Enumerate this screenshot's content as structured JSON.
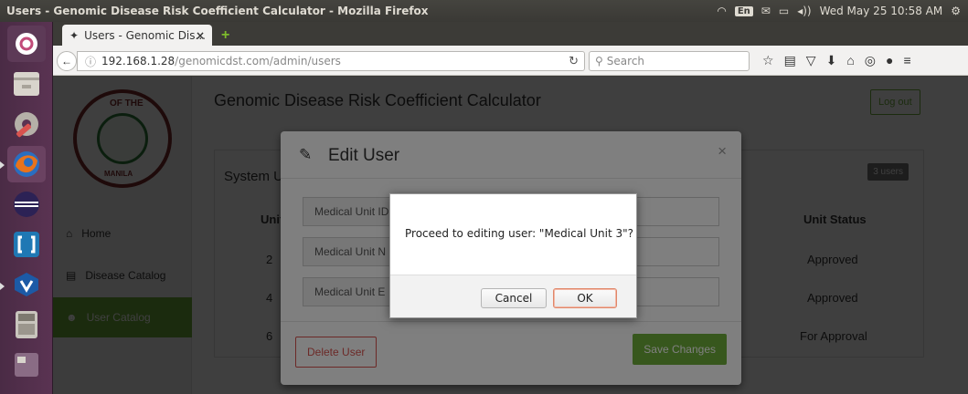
{
  "os_panel": {
    "window_title": "Users - Genomic Disease Risk Coefficient Calculator - Mozilla Firefox",
    "keyboard_indicator": "En",
    "clock": "Wed May 25 10:58 AM"
  },
  "browser": {
    "tab_title": "Users - Genomic Dis...",
    "tab_close": "×",
    "new_tab": "+",
    "url_host": "192.168.1.28",
    "url_path": "/genomicdst.com/admin/users",
    "search_placeholder": "Search"
  },
  "app": {
    "title": "Genomic Disease Risk Coefficient Calculator",
    "logout_label": "Log out",
    "seal_text_top": "OF THE",
    "seal_text_bottom": "MANILA",
    "nav": [
      {
        "label": "Home",
        "icon": "home-icon"
      },
      {
        "label": "Disease Catalog",
        "icon": "document-icon"
      },
      {
        "label": "User Catalog",
        "icon": "users-icon"
      }
    ],
    "panel_title": "System U",
    "users_count_badge": "3 users",
    "columns": {
      "unit_id": "Unit ID",
      "unit_status": "Unit Status"
    },
    "rows": [
      {
        "unit_id": "2",
        "status": "Approved"
      },
      {
        "unit_id": "4",
        "status": "Approved"
      },
      {
        "unit_id": "6",
        "status": "For Approval"
      }
    ]
  },
  "edit_modal": {
    "title": "Edit User",
    "close": "×",
    "fields": [
      {
        "label": "Medical Unit ID",
        "value": ""
      },
      {
        "label": "Medical Unit N",
        "value": ""
      },
      {
        "label": "Medical Unit E",
        "value": ""
      }
    ],
    "delete_label": "Delete User",
    "save_label": "Save Changes"
  },
  "confirm_dialog": {
    "message": "Proceed to editing user: \"Medical Unit 3\"?",
    "cancel_label": "Cancel",
    "ok_label": "OK"
  },
  "colors": {
    "accent_green": "#6fae3b",
    "danger_red": "#d9534f"
  }
}
